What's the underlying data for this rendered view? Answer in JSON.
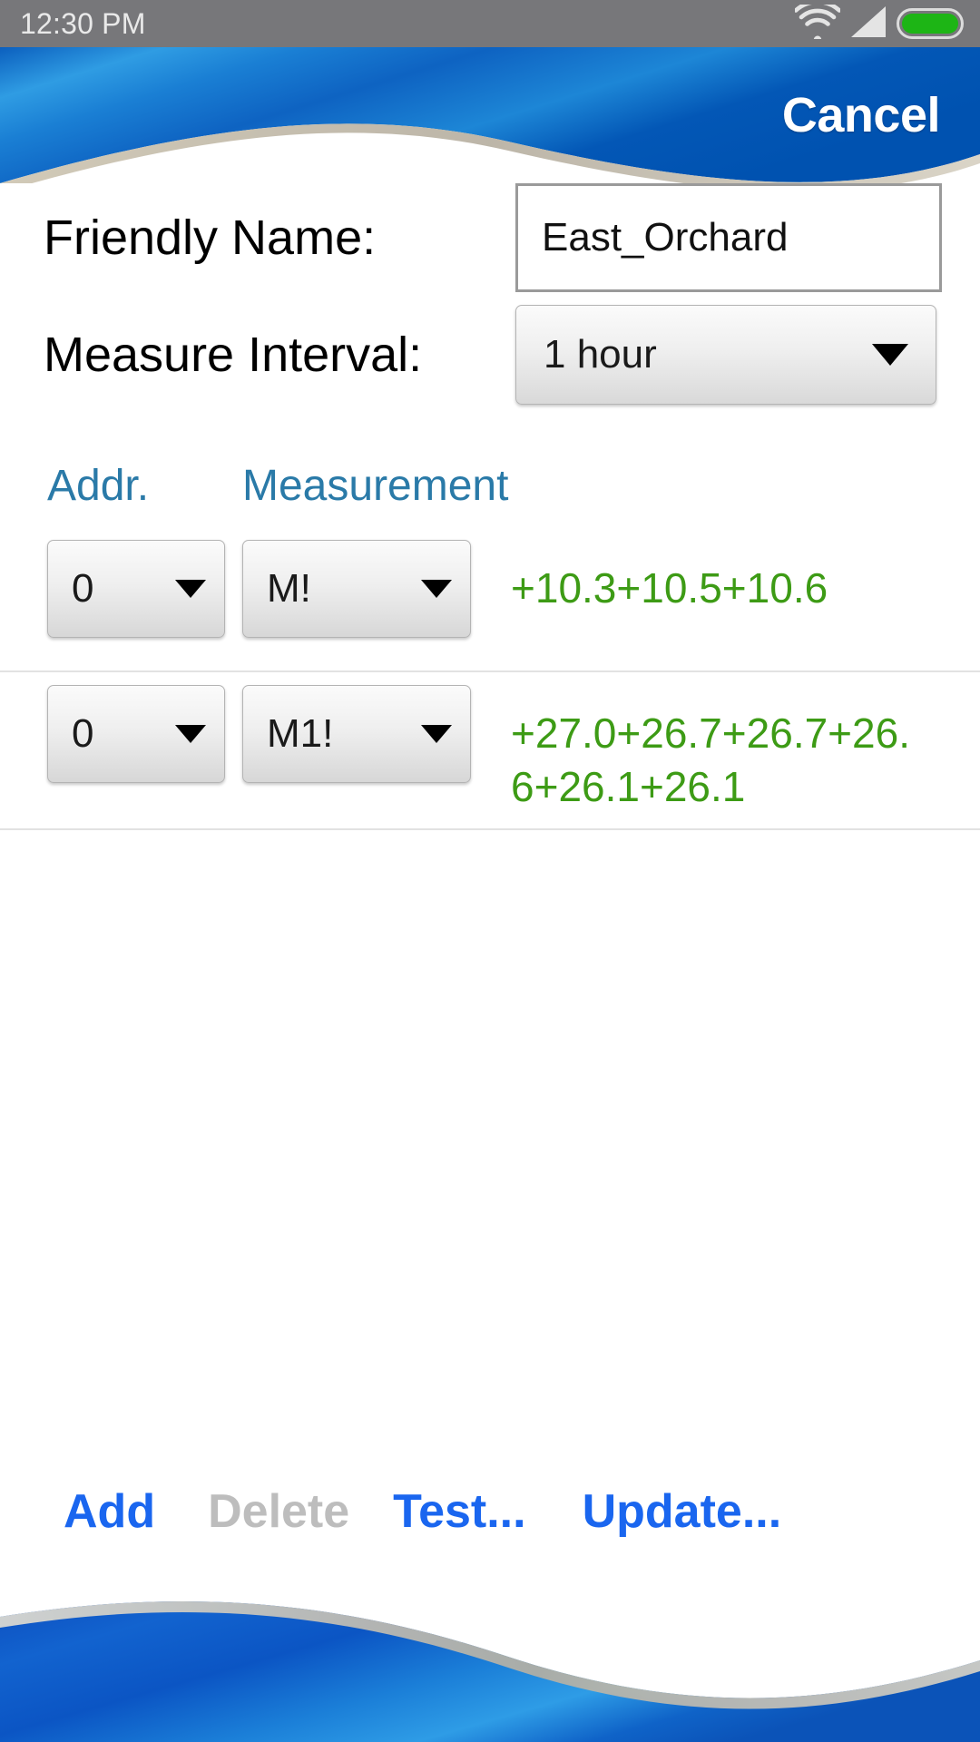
{
  "statusbar": {
    "time": "12:30 PM",
    "wifi_icon": "wifi-icon",
    "signal_icon": "signal-triangle-icon",
    "battery_icon": "battery-icon"
  },
  "header": {
    "cancel_label": "Cancel",
    "banner_color_dark": "#0055b8",
    "banner_color_light": "#2e9ae0"
  },
  "form": {
    "friendly_name_label": "Friendly Name:",
    "friendly_name_value": "East_Orchard",
    "friendly_name_placeholder": "",
    "measure_interval_label": "Measure Interval:",
    "measure_interval_value": "1 hour",
    "dropdown_icon": "chevron-down-icon"
  },
  "table": {
    "columns": [
      "Addr.",
      "Measurement"
    ],
    "header_color": "#2a7aa8",
    "value_color": "#3d9b15",
    "rows": [
      {
        "addr": "0",
        "measurement": "M!",
        "value": "+10.3+10.5+10.6"
      },
      {
        "addr": "0",
        "measurement": "M1!",
        "value": "+27.0+26.7+26.7+26.6+26.1+26.1"
      }
    ]
  },
  "actions": {
    "add_label": "Add",
    "delete_label": "Delete",
    "test_label": "Test...",
    "update_label": "Update...",
    "enabled_color": "#1a66ef",
    "disabled_color": "#bdbdbd"
  }
}
